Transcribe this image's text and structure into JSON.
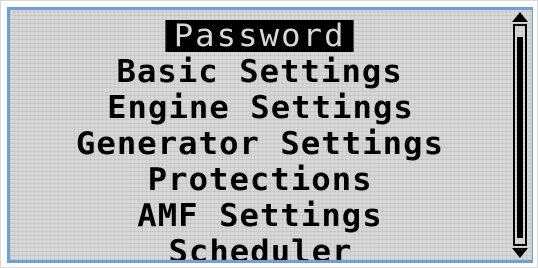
{
  "menu": {
    "items": [
      {
        "label": "Password",
        "selected": true
      },
      {
        "label": "Basic Settings",
        "selected": false
      },
      {
        "label": "Engine Settings",
        "selected": false
      },
      {
        "label": "Generator Settings",
        "selected": false
      },
      {
        "label": "Protections",
        "selected": false
      },
      {
        "label": "AMF Settings",
        "selected": false
      },
      {
        "label": "Scheduler",
        "selected": false
      }
    ]
  },
  "scrollbar": {
    "up_icon": "triangle-up-icon",
    "down_icon": "triangle-down-icon",
    "thumb_start_fraction": 0.05,
    "thumb_size_fraction": 0.92
  },
  "colors": {
    "lcd_background": "#d8d8d8",
    "text": "#000000",
    "highlight_background": "#000000",
    "highlight_text": "#d8d8d8",
    "frame_accent": "#6fa0de"
  }
}
